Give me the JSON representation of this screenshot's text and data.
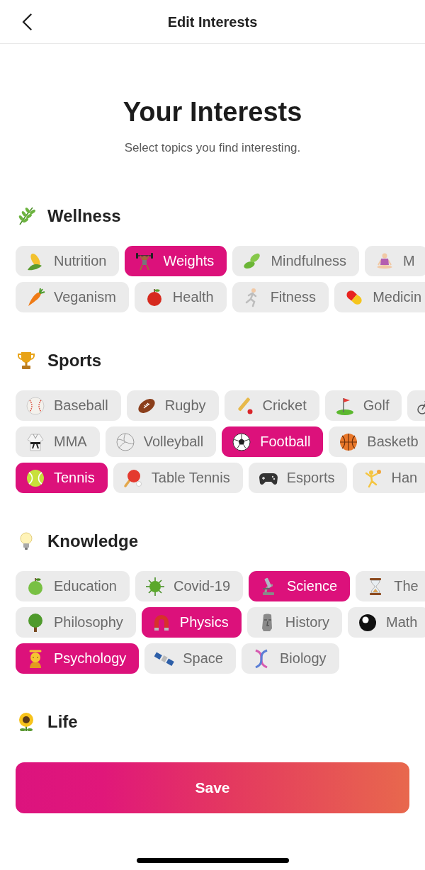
{
  "header": {
    "title": "Edit Interests"
  },
  "intro": {
    "title": "Your Interests",
    "subtitle": "Select topics you find interesting."
  },
  "sections": [
    {
      "title": "Wellness",
      "rows": [
        {
          "chips": [
            {
              "label": "Nutrition",
              "selected": false
            },
            {
              "label": "Weights",
              "selected": true
            },
            {
              "label": "Mindfulness",
              "selected": false
            },
            {
              "label": "M",
              "selected": false
            }
          ]
        },
        {
          "chips": [
            {
              "label": "Veganism",
              "selected": false
            },
            {
              "label": "Health",
              "selected": false
            },
            {
              "label": "Fitness",
              "selected": false
            },
            {
              "label": "Medicin",
              "selected": false
            }
          ]
        }
      ]
    },
    {
      "title": "Sports",
      "rows": [
        {
          "chips": [
            {
              "label": "Baseball",
              "selected": false
            },
            {
              "label": "Rugby",
              "selected": false
            },
            {
              "label": "Cricket",
              "selected": false
            },
            {
              "label": "Golf",
              "selected": false
            },
            {
              "selected": false
            }
          ]
        },
        {
          "chips": [
            {
              "label": "MMA",
              "selected": false
            },
            {
              "label": "Volleyball",
              "selected": false
            },
            {
              "label": "Football",
              "selected": true
            },
            {
              "label": "Basketb",
              "selected": false
            }
          ]
        },
        {
          "chips": [
            {
              "label": "Tennis",
              "selected": true
            },
            {
              "label": "Table Tennis",
              "selected": false
            },
            {
              "label": "Esports",
              "selected": false
            },
            {
              "label": "Han",
              "selected": false
            }
          ]
        }
      ]
    },
    {
      "title": "Knowledge",
      "rows": [
        {
          "chips": [
            {
              "label": "Education",
              "selected": false
            },
            {
              "label": "Covid-19",
              "selected": false
            },
            {
              "label": "Science",
              "selected": true
            },
            {
              "label": "The",
              "selected": false
            }
          ]
        },
        {
          "chips": [
            {
              "label": "Philosophy",
              "selected": false
            },
            {
              "label": "Physics",
              "selected": true
            },
            {
              "label": "History",
              "selected": false
            },
            {
              "label": "Math",
              "selected": false
            }
          ]
        },
        {
          "chips": [
            {
              "label": "Psychology",
              "selected": true
            },
            {
              "label": "Space",
              "selected": false
            },
            {
              "label": "Biology",
              "selected": false
            }
          ]
        }
      ]
    },
    {
      "title": "Life"
    }
  ],
  "save_button": {
    "label": "Save"
  }
}
